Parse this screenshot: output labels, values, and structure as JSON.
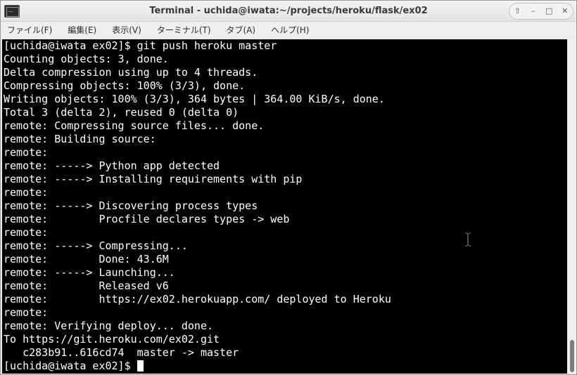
{
  "window": {
    "title": "Terminal - uchida@iwata:~/projects/heroku/flask/ex02"
  },
  "menubar": {
    "items": [
      "ファイル(F)",
      "編集(E)",
      "表示(V)",
      "ターミナル(T)",
      "タブ(A)",
      "ヘルプ(H)"
    ]
  },
  "terminal": {
    "lines": [
      "[uchida@iwata ex02]$ git push heroku master",
      "Counting objects: 3, done.",
      "Delta compression using up to 4 threads.",
      "Compressing objects: 100% (3/3), done.",
      "Writing objects: 100% (3/3), 364 bytes | 364.00 KiB/s, done.",
      "Total 3 (delta 2), reused 0 (delta 0)",
      "remote: Compressing source files... done.",
      "remote: Building source:",
      "remote:",
      "remote: -----> Python app detected",
      "remote: -----> Installing requirements with pip",
      "remote:",
      "remote: -----> Discovering process types",
      "remote:        Procfile declares types -> web",
      "remote:",
      "remote: -----> Compressing...",
      "remote:        Done: 43.6M",
      "remote: -----> Launching...",
      "remote:        Released v6",
      "remote:        https://ex02.herokuapp.com/ deployed to Heroku",
      "remote:",
      "remote: Verifying deploy... done.",
      "To https://git.heroku.com/ex02.git",
      "   c283b91..616cd74  master -> master"
    ],
    "prompt": "[uchida@iwata ex02]$ "
  },
  "icons": {
    "window_buttons": [
      "up-arrow-icon",
      "minimize-icon",
      "maximize-icon",
      "close-icon"
    ],
    "window_button_glyphs": [
      "⇧",
      "–",
      "□",
      "✕"
    ]
  }
}
